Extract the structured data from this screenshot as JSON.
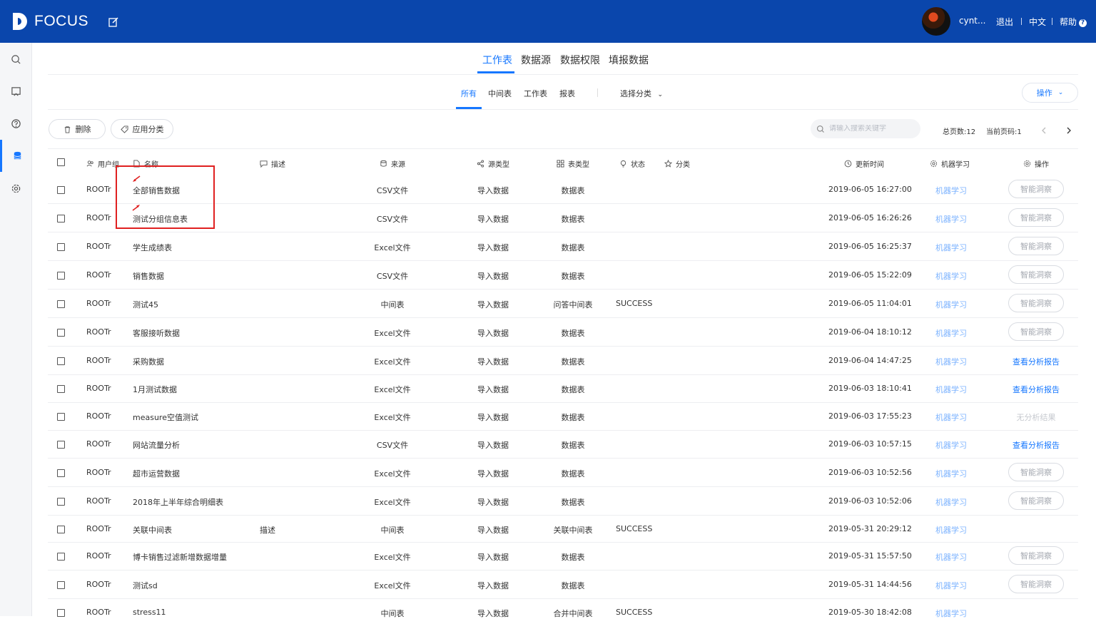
{
  "header": {
    "logo_text": "FOCUS",
    "user_name": "cynt...",
    "logout": "退出",
    "language": "中文",
    "help": "帮助"
  },
  "sidebar": {
    "icons": [
      "search-icon",
      "board-icon",
      "help-icon",
      "database-icon",
      "settings-icon"
    ],
    "active": "database-icon"
  },
  "main_tabs": [
    "工作表",
    "数据源",
    "数据权限",
    "填报数据"
  ],
  "main_tab_active": "工作表",
  "sub_tabs": [
    "所有",
    "中间表",
    "工作表",
    "报表"
  ],
  "sub_tab_active": "所有",
  "category_select": "选择分类",
  "operate_button": "操作",
  "toolbar": {
    "delete_label": "删除",
    "apply_category_label": "应用分类",
    "search_placeholder": "请输入搜索关键字",
    "total_pages": "总页数:12",
    "current_page": "当前页码:1"
  },
  "columns": {
    "user_group": "用户组",
    "name": "名称",
    "description": "描述",
    "source": "来源",
    "source_type": "源类型",
    "table_type": "表类型",
    "status": "状态",
    "category": "分类",
    "update_time": "更新时间",
    "ml": "机器学习",
    "action": "操作"
  },
  "rows": [
    {
      "group": "ROOTr",
      "name": "全部销售数据",
      "desc": "",
      "source": "CSV文件",
      "source_type": "导入数据",
      "table_type": "数据表",
      "status": "",
      "time": "2019-06-05 16:27:00",
      "ml": "机器学习",
      "action": "智能洞察",
      "action_kind": "button"
    },
    {
      "group": "ROOTr",
      "name": "测试分组信息表",
      "desc": "",
      "source": "CSV文件",
      "source_type": "导入数据",
      "table_type": "数据表",
      "status": "",
      "time": "2019-06-05 16:26:26",
      "ml": "机器学习",
      "action": "智能洞察",
      "action_kind": "button"
    },
    {
      "group": "ROOTr",
      "name": "学生成绩表",
      "desc": "",
      "source": "Excel文件",
      "source_type": "导入数据",
      "table_type": "数据表",
      "status": "",
      "time": "2019-06-05 16:25:37",
      "ml": "机器学习",
      "action": "智能洞察",
      "action_kind": "button"
    },
    {
      "group": "ROOTr",
      "name": "销售数据",
      "desc": "",
      "source": "CSV文件",
      "source_type": "导入数据",
      "table_type": "数据表",
      "status": "",
      "time": "2019-06-05 15:22:09",
      "ml": "机器学习",
      "action": "智能洞察",
      "action_kind": "button"
    },
    {
      "group": "ROOTr",
      "name": "测试45",
      "desc": "",
      "source": "中间表",
      "source_type": "导入数据",
      "table_type": "问答中间表",
      "status": "SUCCESS",
      "time": "2019-06-05 11:04:01",
      "ml": "机器学习",
      "action": "智能洞察",
      "action_kind": "button"
    },
    {
      "group": "ROOTr",
      "name": "客服接听数据",
      "desc": "",
      "source": "Excel文件",
      "source_type": "导入数据",
      "table_type": "数据表",
      "status": "",
      "time": "2019-06-04 18:10:12",
      "ml": "机器学习",
      "action": "智能洞察",
      "action_kind": "button"
    },
    {
      "group": "ROOTr",
      "name": "采购数据",
      "desc": "",
      "source": "Excel文件",
      "source_type": "导入数据",
      "table_type": "数据表",
      "status": "",
      "time": "2019-06-04 14:47:25",
      "ml": "机器学习",
      "action": "查看分析报告",
      "action_kind": "link"
    },
    {
      "group": "ROOTr",
      "name": "1月测试数据",
      "desc": "",
      "source": "Excel文件",
      "source_type": "导入数据",
      "table_type": "数据表",
      "status": "",
      "time": "2019-06-03 18:10:41",
      "ml": "机器学习",
      "action": "查看分析报告",
      "action_kind": "link"
    },
    {
      "group": "ROOTr",
      "name": "measure空值测试",
      "desc": "",
      "source": "Excel文件",
      "source_type": "导入数据",
      "table_type": "数据表",
      "status": "",
      "time": "2019-06-03 17:55:23",
      "ml": "机器学习",
      "action": "无分析结果",
      "action_kind": "muted"
    },
    {
      "group": "ROOTr",
      "name": "网站流量分析",
      "desc": "",
      "source": "CSV文件",
      "source_type": "导入数据",
      "table_type": "数据表",
      "status": "",
      "time": "2019-06-03 10:57:15",
      "ml": "机器学习",
      "action": "查看分析报告",
      "action_kind": "link"
    },
    {
      "group": "ROOTr",
      "name": "超市运营数据",
      "desc": "",
      "source": "Excel文件",
      "source_type": "导入数据",
      "table_type": "数据表",
      "status": "",
      "time": "2019-06-03 10:52:56",
      "ml": "机器学习",
      "action": "智能洞察",
      "action_kind": "button"
    },
    {
      "group": "ROOTr",
      "name": "2018年上半年综合明细表",
      "desc": "",
      "source": "Excel文件",
      "source_type": "导入数据",
      "table_type": "数据表",
      "status": "",
      "time": "2019-06-03 10:52:06",
      "ml": "机器学习",
      "action": "智能洞察",
      "action_kind": "button"
    },
    {
      "group": "ROOTr",
      "name": "关联中间表",
      "desc": "描述",
      "source": "中间表",
      "source_type": "导入数据",
      "table_type": "关联中间表",
      "status": "SUCCESS",
      "time": "2019-05-31 20:29:12",
      "ml": "机器学习",
      "action": "",
      "action_kind": "none"
    },
    {
      "group": "ROOTr",
      "name": "博卡销售过滤新增数据增量",
      "desc": "",
      "source": "Excel文件",
      "source_type": "导入数据",
      "table_type": "数据表",
      "status": "",
      "time": "2019-05-31 15:57:50",
      "ml": "机器学习",
      "action": "智能洞察",
      "action_kind": "button"
    },
    {
      "group": "ROOTr",
      "name": "测试sd",
      "desc": "",
      "source": "Excel文件",
      "source_type": "导入数据",
      "table_type": "数据表",
      "status": "",
      "time": "2019-05-31 14:44:56",
      "ml": "机器学习",
      "action": "智能洞察",
      "action_kind": "button"
    },
    {
      "group": "ROOTr",
      "name": "stress11",
      "desc": "",
      "source": "中间表",
      "source_type": "导入数据",
      "table_type": "合并中间表",
      "status": "SUCCESS",
      "time": "2019-05-30 18:42:08",
      "ml": "机器学习",
      "action": "",
      "action_kind": "none"
    }
  ],
  "colors": {
    "header_bg": "#0a46ac",
    "accent": "#1677ff",
    "highlight": "#e02020"
  }
}
